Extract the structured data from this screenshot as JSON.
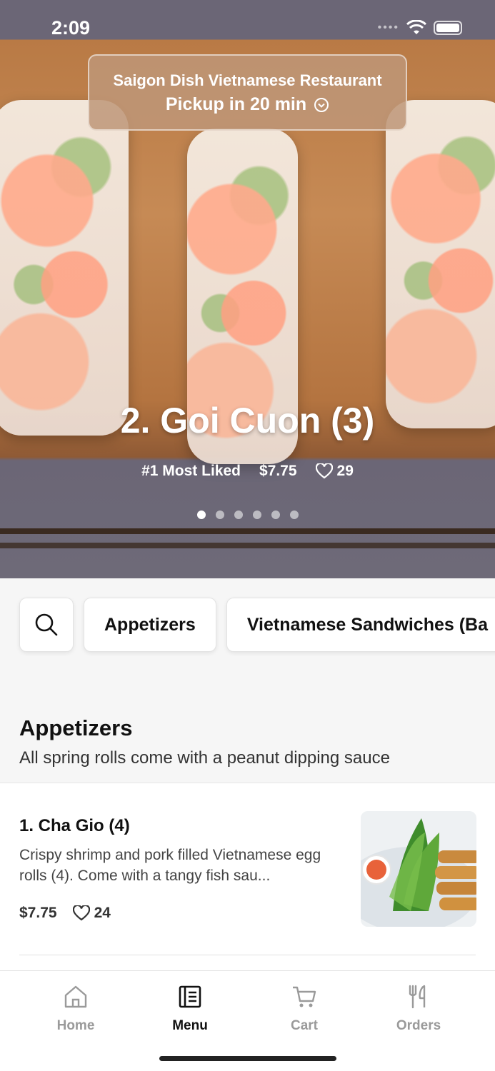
{
  "status_bar": {
    "time": "2:09"
  },
  "restaurant": {
    "name": "Saigon Dish Vietnamese Restaurant",
    "pickup": "Pickup in 20 min"
  },
  "hero": {
    "title": "2. Goi Cuon (3)",
    "badge": "#1 Most Liked",
    "price": "$7.75",
    "likes": "29",
    "slides": 6,
    "active_slide": 1
  },
  "categories": {
    "search_icon": "search-icon",
    "items": [
      "Appetizers",
      "Vietnamese Sandwiches (Ba"
    ]
  },
  "section": {
    "title": "Appetizers",
    "subtitle": "All spring rolls come with a peanut dipping sauce"
  },
  "item": {
    "name": "1. Cha Gio (4)",
    "description": "Crispy shrimp and pork filled Vietnamese egg rolls (4). Come with a tangy fish sau...",
    "price": "$7.75",
    "likes": "24"
  },
  "tabs": [
    {
      "label": "Home",
      "icon": "home-icon"
    },
    {
      "label": "Menu",
      "icon": "menu-icon",
      "active": true
    },
    {
      "label": "Cart",
      "icon": "cart-icon"
    },
    {
      "label": "Orders",
      "icon": "orders-icon"
    }
  ],
  "colors": {
    "accent": "#111111",
    "inactive": "#9a9a9a",
    "pill": "#be9678"
  }
}
